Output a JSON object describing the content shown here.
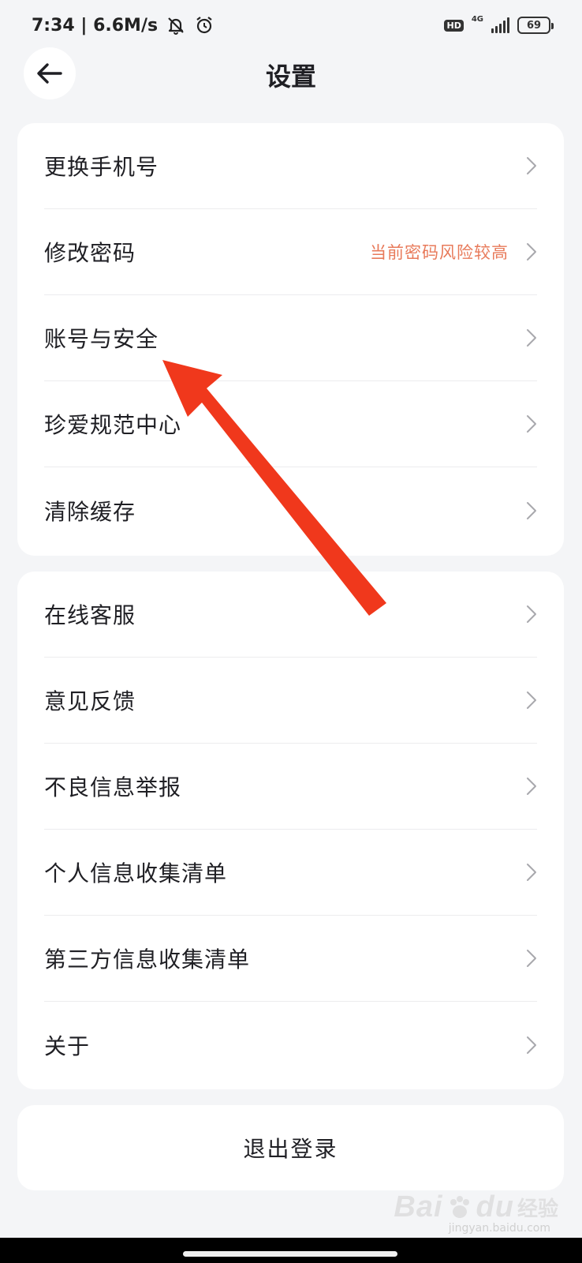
{
  "status_bar": {
    "time_speed": "7:34 | 6.6M/s",
    "hd": "HD",
    "network": "4G",
    "battery": "69"
  },
  "header": {
    "title": "设置"
  },
  "group_1": {
    "items": [
      {
        "label": "更换手机号",
        "hint": ""
      },
      {
        "label": "修改密码",
        "hint": "当前密码风险较高"
      },
      {
        "label": "账号与安全",
        "hint": ""
      },
      {
        "label": "珍爱规范中心",
        "hint": ""
      },
      {
        "label": "清除缓存",
        "hint": ""
      }
    ]
  },
  "group_2": {
    "items": [
      {
        "label": "在线客服"
      },
      {
        "label": "意见反馈"
      },
      {
        "label": "不良信息举报"
      },
      {
        "label": "个人信息收集清单"
      },
      {
        "label": "第三方信息收集清单"
      },
      {
        "label": "关于"
      }
    ]
  },
  "logout": {
    "label": "退出登录"
  },
  "watermark": {
    "brand": "Bai",
    "brand_suffix": "du",
    "cn": "经验",
    "url": "jingyan.baidu.com"
  },
  "colors": {
    "background": "#f4f5f7",
    "card": "#ffffff",
    "hint": "#e87a5a",
    "arrow": "#f0381c"
  }
}
